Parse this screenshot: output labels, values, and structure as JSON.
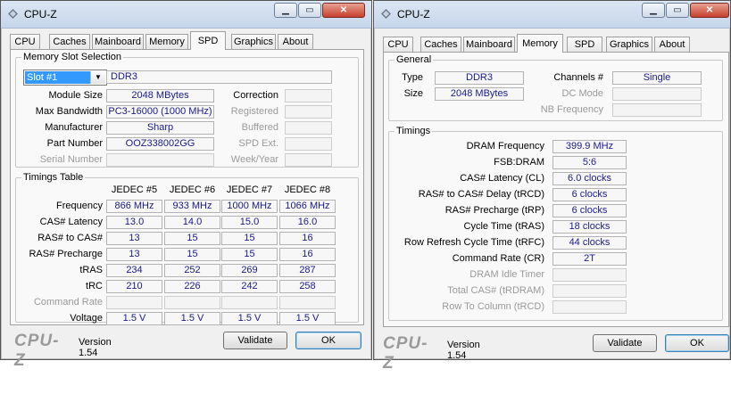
{
  "left_window": {
    "title": "CPU-Z",
    "tabs": [
      "CPU",
      "Caches",
      "Mainboard",
      "Memory",
      "SPD",
      "Graphics",
      "About"
    ],
    "active_tab": "SPD",
    "slot_group_label": "Memory Slot Selection",
    "slot_selected": "Slot #1",
    "slot_type": "DDR3",
    "module_size_label": "Module Size",
    "module_size": "2048 MBytes",
    "max_bandwidth_label": "Max Bandwidth",
    "max_bandwidth": "PC3-16000 (1000 MHz)",
    "manufacturer_label": "Manufacturer",
    "manufacturer": "Sharp",
    "part_number_label": "Part Number",
    "part_number": "OOZ338002GG",
    "serial_number_label": "Serial Number",
    "correction_label": "Correction",
    "registered_label": "Registered",
    "buffered_label": "Buffered",
    "spd_ext_label": "SPD Ext.",
    "week_year_label": "Week/Year",
    "timings_group_label": "Timings Table",
    "jedec_headers": [
      "JEDEC #5",
      "JEDEC #6",
      "JEDEC #7",
      "JEDEC #8"
    ],
    "rows": [
      {
        "label": "Frequency",
        "values": [
          "866 MHz",
          "933 MHz",
          "1000 MHz",
          "1066 MHz"
        ]
      },
      {
        "label": "CAS# Latency",
        "values": [
          "13.0",
          "14.0",
          "15.0",
          "16.0"
        ]
      },
      {
        "label": "RAS# to CAS#",
        "values": [
          "13",
          "15",
          "15",
          "16"
        ]
      },
      {
        "label": "RAS# Precharge",
        "values": [
          "13",
          "15",
          "15",
          "16"
        ]
      },
      {
        "label": "tRAS",
        "values": [
          "234",
          "252",
          "269",
          "287"
        ]
      },
      {
        "label": "tRC",
        "values": [
          "210",
          "226",
          "242",
          "258"
        ]
      }
    ],
    "command_rate_label": "Command Rate",
    "voltage_label": "Voltage",
    "voltages": [
      "1.5 V",
      "1.5 V",
      "1.5 V",
      "1.5 V"
    ],
    "brand": "CPU-Z",
    "version": "Version 1.54",
    "validate_label": "Validate",
    "ok_label": "OK"
  },
  "right_window": {
    "title": "CPU-Z",
    "tabs": [
      "CPU",
      "Caches",
      "Mainboard",
      "Memory",
      "SPD",
      "Graphics",
      "About"
    ],
    "active_tab": "Memory",
    "general_label": "General",
    "type_label": "Type",
    "type": "DDR3",
    "size_label": "Size",
    "size": "2048 MBytes",
    "channels_label": "Channels #",
    "channels": "Single",
    "dc_mode_label": "DC Mode",
    "nb_frequency_label": "NB Frequency",
    "timings_label": "Timings",
    "timings": [
      {
        "label": "DRAM Frequency",
        "value": "399.9 MHz"
      },
      {
        "label": "FSB:DRAM",
        "value": "5:6"
      },
      {
        "label": "CAS# Latency (CL)",
        "value": "6.0 clocks"
      },
      {
        "label": "RAS# to CAS# Delay (tRCD)",
        "value": "6 clocks"
      },
      {
        "label": "RAS# Precharge (tRP)",
        "value": "6 clocks"
      },
      {
        "label": "Cycle Time (tRAS)",
        "value": "18 clocks"
      },
      {
        "label": "Row Refresh Cycle Time (tRFC)",
        "value": "44 clocks"
      },
      {
        "label": "Command Rate (CR)",
        "value": "2T"
      }
    ],
    "disabled_timings": [
      "DRAM Idle Timer",
      "Total CAS# (tRDRAM)",
      "Row To Column (tRCD)"
    ],
    "brand": "CPU-Z",
    "version": "Version 1.54",
    "validate_label": "Validate",
    "ok_label": "OK"
  },
  "colors": {
    "value_text": "#1a1a8c",
    "selection": "#3399ff",
    "close_button": "#c7402d"
  },
  "icons": [
    "app-icon",
    "minimize-icon",
    "maximize-icon",
    "close-icon",
    "dropdown-arrow-icon"
  ]
}
